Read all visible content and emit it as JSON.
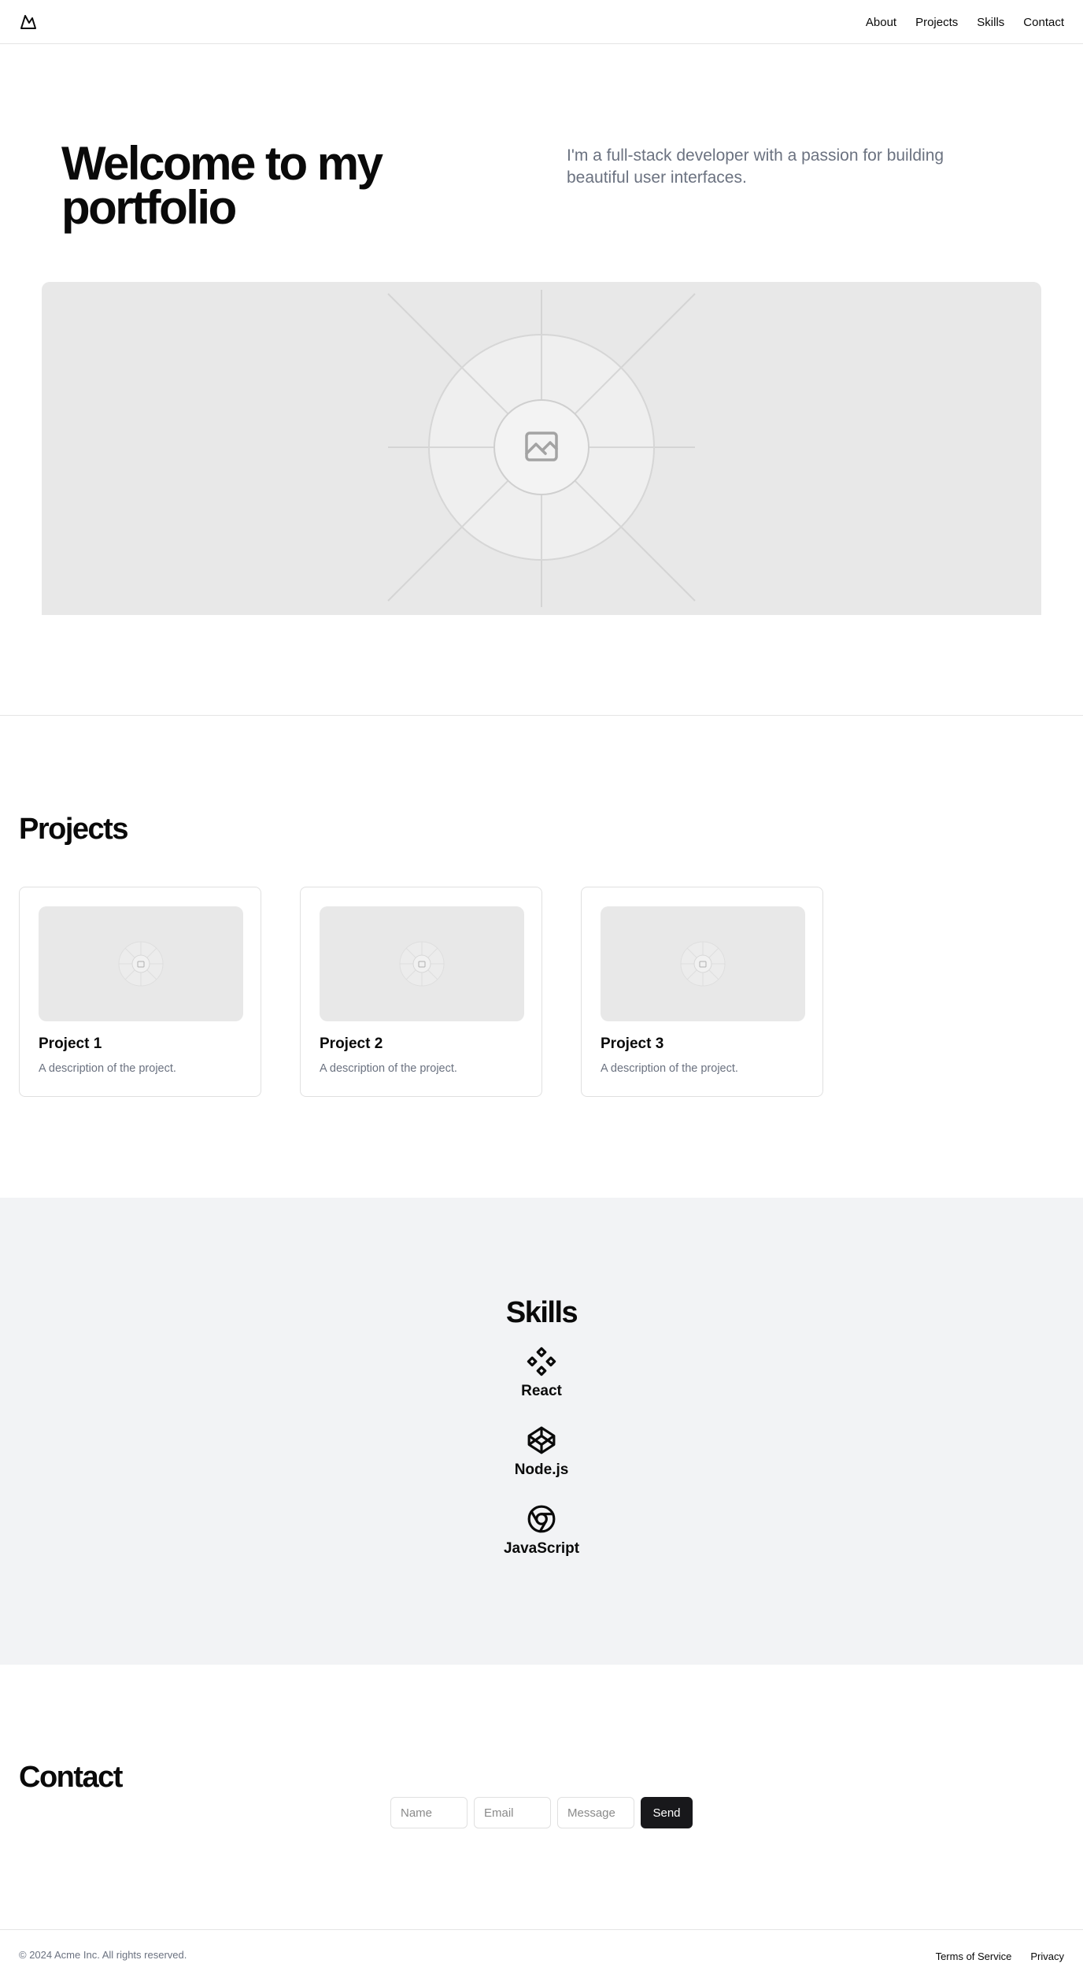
{
  "header": {
    "logo_icon": "mountain-icon",
    "nav": [
      {
        "label": "About"
      },
      {
        "label": "Projects"
      },
      {
        "label": "Skills"
      },
      {
        "label": "Contact"
      }
    ]
  },
  "hero": {
    "title": "Welcome to my portfolio",
    "subtitle": "I'm a full-stack developer with a passion for building beautiful user interfaces.",
    "image_icon": "image-placeholder-icon"
  },
  "projects": {
    "heading": "Projects",
    "items": [
      {
        "title": "Project 1",
        "description": "A description of the project."
      },
      {
        "title": "Project 2",
        "description": "A description of the project."
      },
      {
        "title": "Project 3",
        "description": "A description of the project."
      }
    ]
  },
  "skills": {
    "heading": "Skills",
    "items": [
      {
        "label": "React",
        "icon": "component-icon"
      },
      {
        "label": "Node.js",
        "icon": "codepen-icon"
      },
      {
        "label": "JavaScript",
        "icon": "chrome-icon"
      }
    ]
  },
  "contact": {
    "heading": "Contact",
    "name_placeholder": "Name",
    "email_placeholder": "Email",
    "message_placeholder": "Message",
    "send_label": "Send"
  },
  "footer": {
    "copyright": "© 2024 Acme Inc. All rights reserved.",
    "links": [
      {
        "label": "Terms of Service"
      },
      {
        "label": "Privacy"
      }
    ]
  },
  "colors": {
    "text": "#0a0a0a",
    "muted": "#6b7280",
    "placeholder_bg": "#e8e8e8",
    "skills_bg": "#f2f3f5",
    "button_bg": "#18181b"
  }
}
